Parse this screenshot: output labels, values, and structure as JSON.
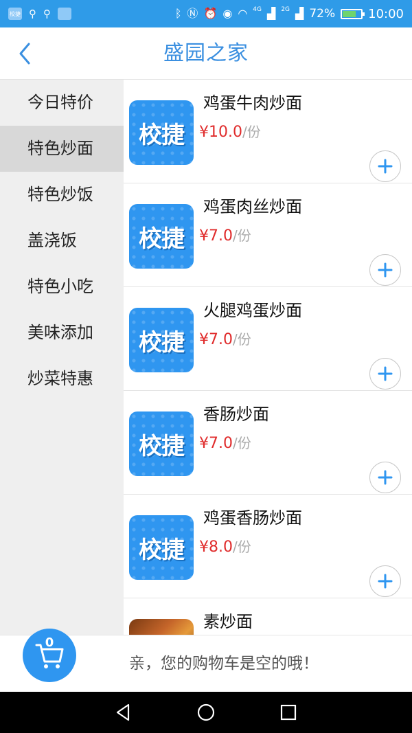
{
  "status_bar": {
    "app_icon_label": "校捷",
    "battery_percent": "72%",
    "time": "10:00",
    "network_4g": "4G",
    "network_2g": "2G",
    "battery_level": 0.72
  },
  "header": {
    "title": "盛园之家"
  },
  "sidebar": {
    "items": [
      {
        "label": "今日特价"
      },
      {
        "label": "特色炒面"
      },
      {
        "label": "特色炒饭"
      },
      {
        "label": "盖浇饭"
      },
      {
        "label": "特色小吃"
      },
      {
        "label": "美味添加"
      },
      {
        "label": "炒菜特惠"
      }
    ],
    "active_index": 1
  },
  "products": [
    {
      "name": "鸡蛋牛肉炒面",
      "price": "¥10.0",
      "unit": "/份",
      "image_label": "校捷",
      "image": "logo"
    },
    {
      "name": "鸡蛋肉丝炒面",
      "price": "¥7.0",
      "unit": "/份",
      "image_label": "校捷",
      "image": "logo"
    },
    {
      "name": "火腿鸡蛋炒面",
      "price": "¥7.0",
      "unit": "/份",
      "image_label": "校捷",
      "image": "logo"
    },
    {
      "name": "香肠炒面",
      "price": "¥7.0",
      "unit": "/份",
      "image_label": "校捷",
      "image": "logo"
    },
    {
      "name": "鸡蛋香肠炒面",
      "price": "¥8.0",
      "unit": "/份",
      "image_label": "校捷",
      "image": "logo"
    },
    {
      "name": "素炒面",
      "price": "",
      "unit": "",
      "image_label": "",
      "image": "photo"
    }
  ],
  "cart": {
    "count": "0",
    "empty_message": "亲，您的购物车是空的哦！"
  },
  "colors": {
    "primary": "#2f96f0",
    "title": "#3a8fe0",
    "price": "#e02c2c",
    "sidebar_bg": "#efefef",
    "sidebar_active": "#d8d8d8"
  },
  "icons": {
    "back": "back-chevron-icon",
    "add": "plus-icon",
    "cart": "shopping-cart-icon",
    "nav_back": "triangle-back-icon",
    "nav_home": "circle-home-icon",
    "nav_recent": "square-recent-icon"
  }
}
